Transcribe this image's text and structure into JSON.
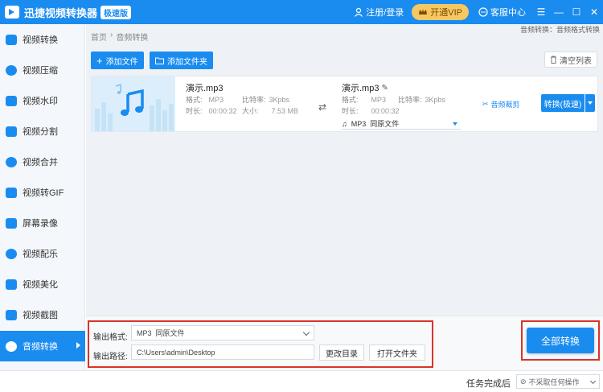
{
  "app": {
    "title": "迅捷视频转换器",
    "badge": "极速版",
    "login": "注册/登录",
    "vip": "开通VIP",
    "service": "客服中心",
    "win_menu": "☰",
    "win_min": "—",
    "win_max": "☐",
    "win_close": "✕"
  },
  "sidebar": {
    "items": [
      {
        "label": "视频转换",
        "icon": "video-convert-icon"
      },
      {
        "label": "视频压缩",
        "icon": "video-compress-icon"
      },
      {
        "label": "视频水印",
        "icon": "video-watermark-icon"
      },
      {
        "label": "视频分割",
        "icon": "video-split-icon"
      },
      {
        "label": "视频合并",
        "icon": "video-merge-icon"
      },
      {
        "label": "视频转GIF",
        "icon": "video-gif-icon"
      },
      {
        "label": "屏幕录像",
        "icon": "screen-record-icon"
      },
      {
        "label": "视频配乐",
        "icon": "video-music-icon"
      },
      {
        "label": "视频美化",
        "icon": "video-beautify-icon"
      },
      {
        "label": "视频截图",
        "icon": "video-screenshot-icon"
      },
      {
        "label": "音频转换",
        "icon": "audio-convert-icon",
        "active": true
      }
    ]
  },
  "breadcrumb": {
    "home": "首页",
    "sep": "›",
    "current": "音频转换"
  },
  "top_note": "音频转换：音频格式转换",
  "toolbar": {
    "add_file": "添加文件",
    "add_folder": "添加文件夹",
    "clear_list": "清空列表"
  },
  "file": {
    "source": {
      "name": "演示.mp3",
      "format_label": "格式:",
      "format": "MP3",
      "bitrate_label": "比特率:",
      "bitrate": "3Kpbs",
      "duration_label": "时长:",
      "duration": "00:00:32",
      "size_label": "大小:",
      "size": "7.53 MB"
    },
    "target": {
      "name": "演示.mp3",
      "format_label": "格式:",
      "format": "MP3",
      "bitrate_label": "比特率:",
      "bitrate": "3Kpbs",
      "duration_label": "时长:",
      "duration": "00:00:32",
      "select_format": "MP3",
      "select_quality": "同原文件"
    },
    "cut_label": "音频裁剪",
    "convert_label": "转换(极速)"
  },
  "output": {
    "format_label": "输出格式:",
    "format_value": "MP3",
    "format_quality": "同原文件",
    "path_label": "输出路径:",
    "path_value": "C:\\Users\\admin\\Desktop",
    "change_dir": "更改目录",
    "open_folder": "打开文件夹",
    "convert_all": "全部转换"
  },
  "status": {
    "after_label": "任务完成后",
    "after_value": "不采取任何操作"
  }
}
